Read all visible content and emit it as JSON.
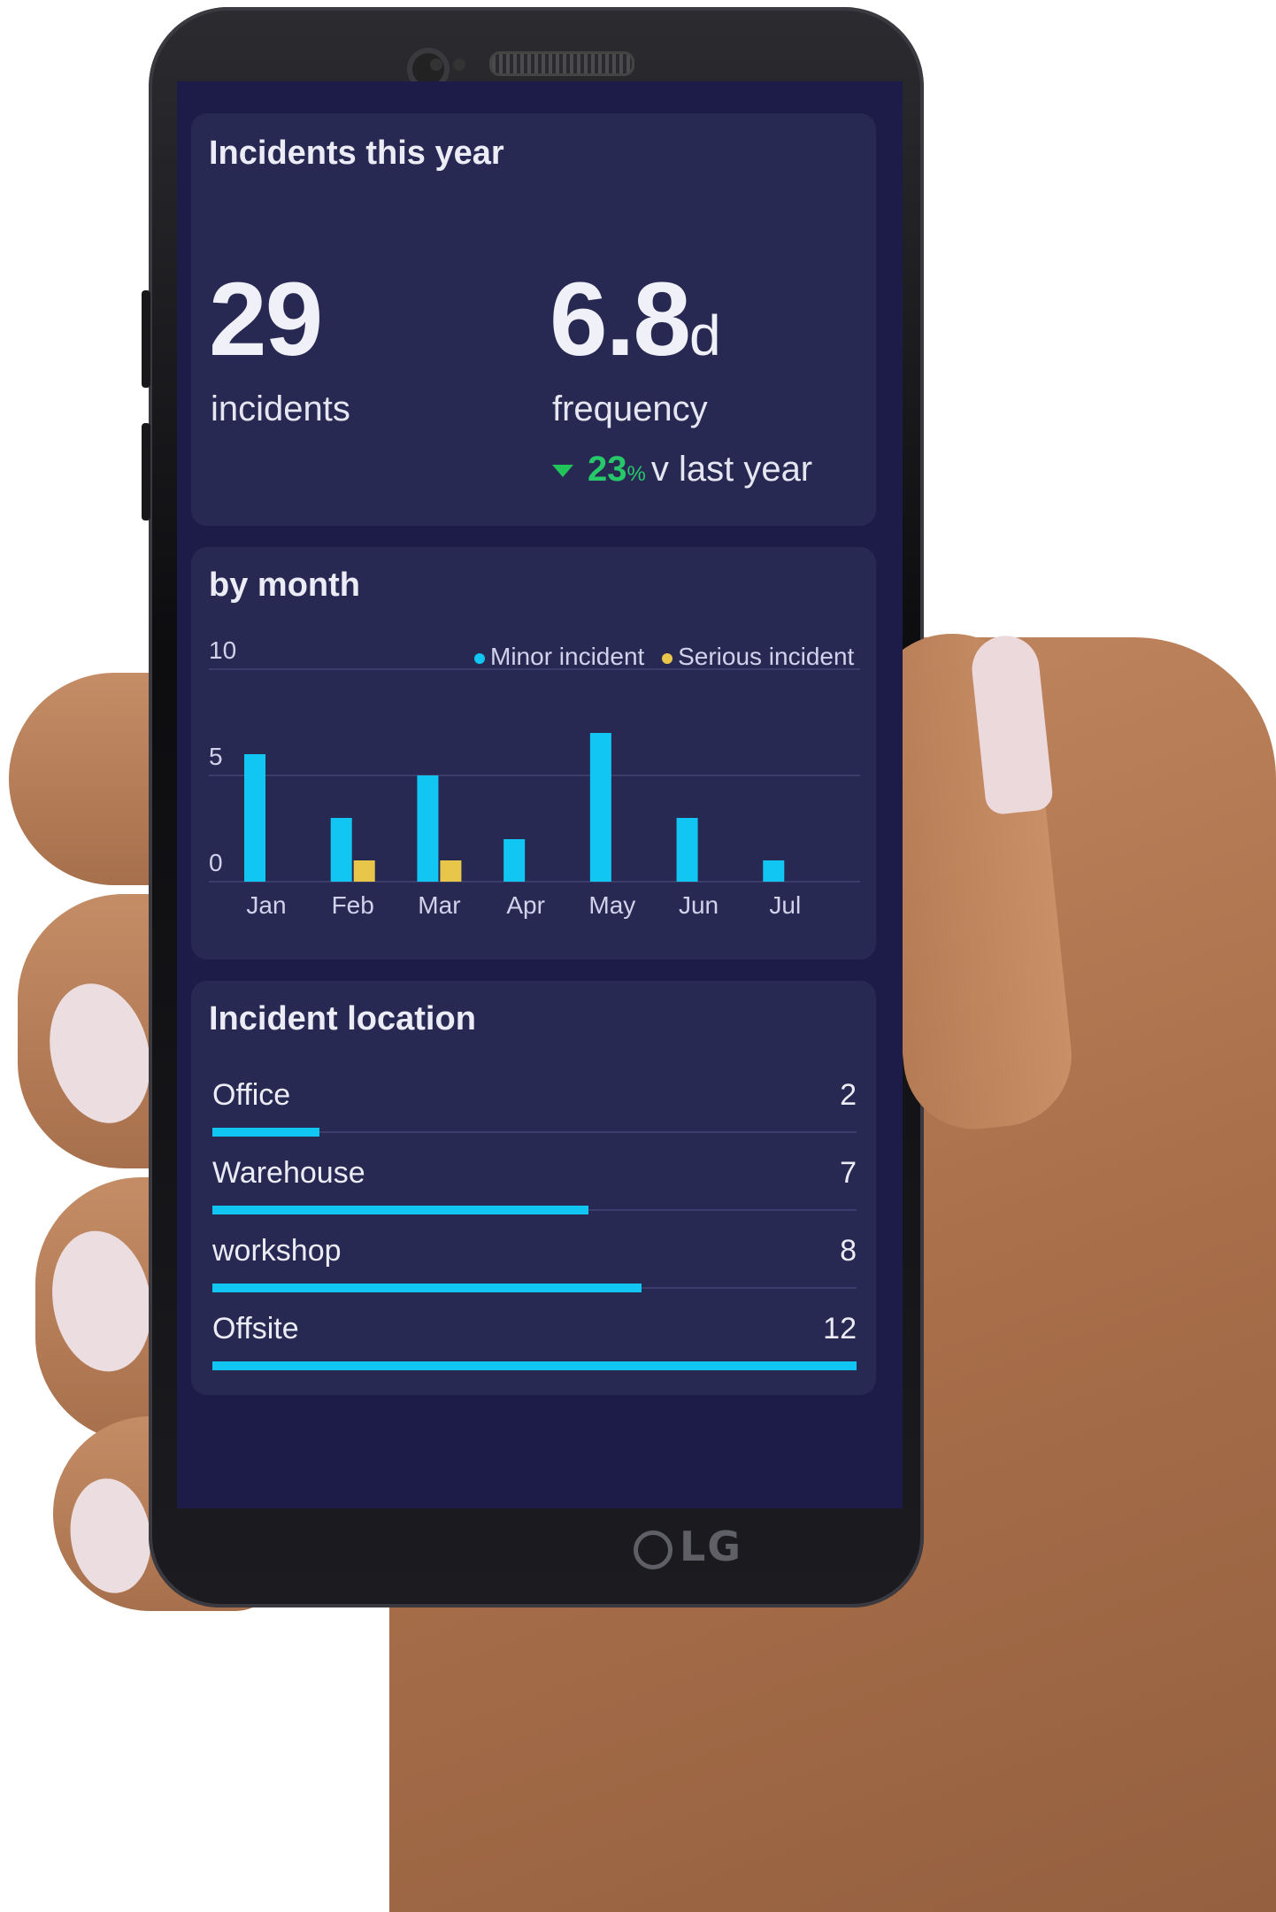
{
  "summary": {
    "title": "Incidents this year",
    "incidents_value": "29",
    "incidents_label": "incidents",
    "frequency_value": "6.8",
    "frequency_unit": "d",
    "frequency_label": "frequency",
    "change_value": "23",
    "change_unit": "%",
    "change_text": "v last year",
    "change_direction": "down"
  },
  "by_month": {
    "title": "by month",
    "legend": [
      "Minor incident",
      "Serious incident"
    ]
  },
  "chart_data": {
    "type": "bar",
    "categories": [
      "Jan",
      "Feb",
      "Mar",
      "Apr",
      "May",
      "Jun",
      "Jul"
    ],
    "series": [
      {
        "name": "Minor incident",
        "values": [
          6,
          3,
          5,
          2,
          7,
          3,
          1
        ],
        "color": "#11c6f3"
      },
      {
        "name": "Serious incident",
        "values": [
          0,
          1,
          1,
          0,
          0,
          0,
          0
        ],
        "color": "#e8c64a"
      }
    ],
    "yticks": [
      "0",
      "5",
      "10"
    ],
    "ylim": [
      0,
      10
    ],
    "grid": true,
    "legend_position": "top-right"
  },
  "locations": {
    "title": "Incident location",
    "max": 12,
    "items": [
      {
        "name": "Office",
        "value": 2
      },
      {
        "name": "Warehouse",
        "value": 7
      },
      {
        "name": "workshop",
        "value": 8
      },
      {
        "name": "Offsite",
        "value": 12
      }
    ]
  },
  "device": {
    "brand": "LG"
  },
  "colors": {
    "screen_bg": "#1d1b48",
    "card_bg": "#282953",
    "accent": "#11c6f3",
    "serious": "#e8c64a",
    "positive": "#27c86a"
  }
}
